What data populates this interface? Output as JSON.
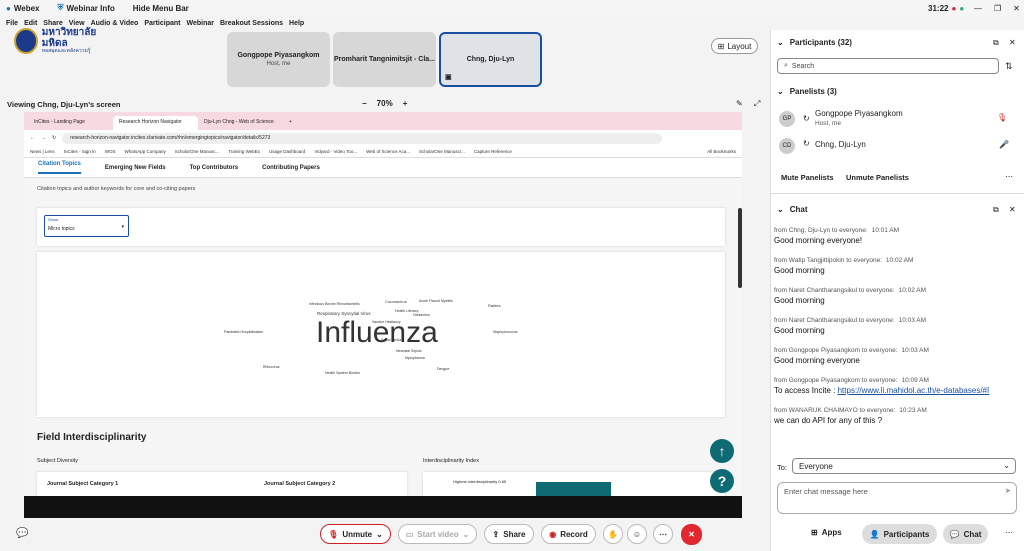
{
  "titlebar": {
    "app": "Webex",
    "info": "Webinar Info",
    "hide": "Hide Menu Bar",
    "time": "31:22"
  },
  "menu": [
    "File",
    "Edit",
    "Share",
    "View",
    "Audio & Video",
    "Participant",
    "Webinar",
    "Breakout Sessions",
    "Help"
  ],
  "logo": {
    "thai": "มหาวิทยาลัยมหิดล",
    "sub": "หอสมุดและคลังความรู้"
  },
  "tiles": [
    {
      "name": "Gongpope Piyasangkom",
      "sub": "Host, me"
    },
    {
      "name": "Promharit Tangnimitsjit - Cla...",
      "sub": ""
    },
    {
      "name": "Chng, Dju-Lyn",
      "sub": ""
    }
  ],
  "layout_label": "Layout",
  "viewing": "Viewing Chng, Dju-Lyn's screen",
  "zoom": "70%",
  "browser": {
    "tabs": [
      "InCites - Landing Page",
      "Research Horizon Navigator",
      "Dju-Lyn Chng - Web of Science"
    ],
    "url": "research-horizon-navigator.incites.clarivate.com/rhn/emergingtopics/navigator/details/5273",
    "bookmarks": [
      "News | Lens",
      "InCites - Sign In",
      "WOS",
      "WhatsApp Company",
      "ScholarOne Manusc...",
      "Training WebEx",
      "Usage Dashboard",
      "Vidyard - Video Too...",
      "Web of Science Aca...",
      "ScholarOne Manuscr...",
      "Capture Reference",
      "All Bookmarks"
    ],
    "nav": [
      "Citation Topics",
      "Emerging New Fields",
      "Top Contributors",
      "Contributing Papers"
    ],
    "subtitle": "Citation topics and author keywords for core and co-citing papers",
    "show_label": "Show",
    "select_value": "Micro topics",
    "cloud_main": "Influenza",
    "cloud_words": [
      "Respiratory Syncytial Virus",
      "Infectious Bovine Rhinotracheitis",
      "Coronavirus",
      "Acute Flaccid Myelitis",
      "Health Literacy",
      "Rabies",
      "Hantavirus",
      "Vaccine Hesitancy",
      "Food Security",
      "Paediatric Hospitalisation",
      "Neonatal Sepsis",
      "Mycoplasma",
      "Bovine Viral Diarrhoea Virus",
      "Rhinovirus",
      "Bacterial Pneumonia",
      "Health System Burden",
      "Staphylococcus",
      "Social Media",
      "Dengue",
      "Nasopharyngeal Carriage"
    ],
    "field_title": "Field Interdisciplinarity",
    "subject_diversity": "Subject Diversity",
    "interdisc_index": "Interdisciplinarity Index",
    "col1": "Journal Subject Category 1",
    "col2": "Journal Subject Category 2",
    "highest": "Highest interdisciplinarity 0.65"
  },
  "controls": {
    "unmute": "Unmute",
    "start_video": "Start video",
    "share": "Share",
    "record": "Record"
  },
  "participants": {
    "title": "Participants (32)",
    "search_placeholder": "Search",
    "panelists_title": "Panelists (3)",
    "list": [
      {
        "initials": "GP",
        "name": "Gongpope Piyasangkom",
        "role": "Host, me"
      },
      {
        "initials": "CD",
        "name": "Chng, Dju-Lyn",
        "role": ""
      }
    ],
    "mute_all": "Mute Panelists",
    "unmute_all": "Unmute Panelists"
  },
  "chat": {
    "title": "Chat",
    "messages": [
      {
        "meta": "from Chng, Dju-Lyn to everyone:",
        "time": "10:01 AM",
        "text": "Good morning everyone!",
        "link": ""
      },
      {
        "meta": "from Watip Tangjittipokin to everyone:",
        "time": "10:02 AM",
        "text": "Good morning",
        "link": ""
      },
      {
        "meta": "from Naret Chantharangsikul to everyone:",
        "time": "10:02 AM",
        "text": "Good morning",
        "link": ""
      },
      {
        "meta": "from Naret Chantharangsikul to everyone:",
        "time": "10:03 AM",
        "text": "Good morning",
        "link": ""
      },
      {
        "meta": "from Gongpope Piyasangkom to everyone:",
        "time": "10:03 AM",
        "text": "Good morning everyone",
        "link": ""
      },
      {
        "meta": "from Gongpope Piyasangkom to everyone:",
        "time": "10:09 AM",
        "text": "To access Incite : ",
        "link": "https://www.li.mahidol.ac.th/e-databases/#I"
      },
      {
        "meta": "from WANARUK CHAIMAYO to everyone:",
        "time": "10:23 AM",
        "text": "we can do API for any of this ?",
        "link": ""
      }
    ],
    "to_label": "To:",
    "to_value": "Everyone",
    "input_placeholder": "Enter chat message here"
  },
  "bottom_tabs": {
    "apps": "Apps",
    "participants": "Participants",
    "chat": "Chat"
  }
}
